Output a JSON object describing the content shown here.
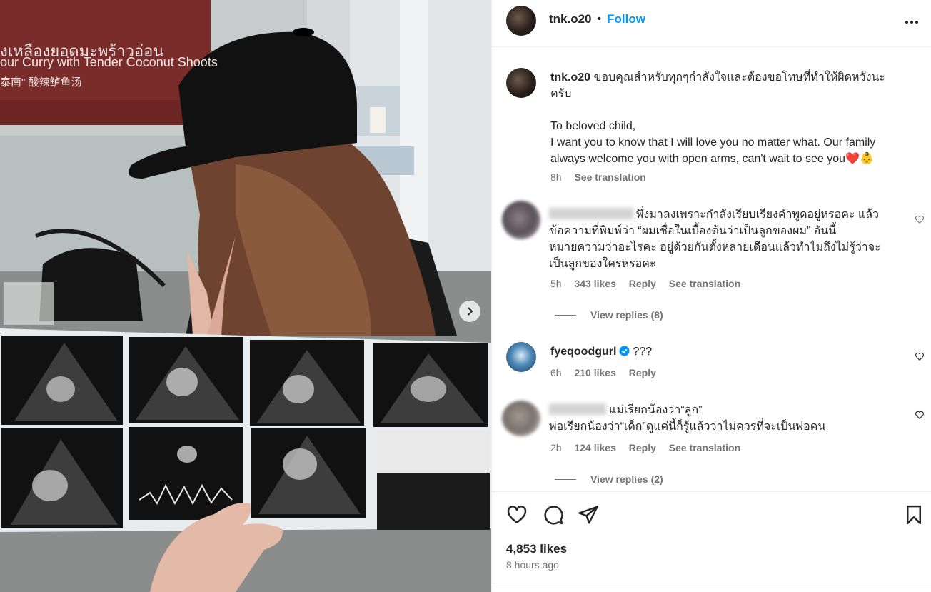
{
  "post": {
    "username": "tnk.o20",
    "separator": "•",
    "follow_label": "Follow",
    "caption_line1": "ขอบคุณสำหรับทุกๆกำลังใจและต้องขอโทษที่ทำให้ผิดหวังนะ",
    "caption_line2": "ครับ",
    "caption_en1": "To beloved child,",
    "caption_en2": "I want you to know that I will love you no matter what. Our family",
    "caption_en3": "always welcome you with open arms, can't wait to see you",
    "caption_emoji": "❤️👶",
    "caption_time": "8h",
    "see_translation": "See translation"
  },
  "media_sign": {
    "thai": "งเหลืองยอดมะพร้าวอ่อน",
    "en": "our Curry with Tender Coconut Shoots",
    "cn": "泰南\" 酸辣鲈鱼汤"
  },
  "comments": [
    {
      "line1": "พึ่งมาลงเพราะกำลังเรียบเรียงคำพูดอยู่หรอคะ แล้ว",
      "line2": "ข้อความที่พิมพ์ว่า “ผมเชื่อในเบื้องต้นว่าเป็นลูกของผม” อันนี้",
      "line3": "หมายความว่าอะไรคะ อยู่ด้วยกันตั้งหลายเดือนแล้วทำไมถึงไม่รู้ว่าจะ",
      "line4": "เป็นลูกของใครหรอคะ",
      "time": "5h",
      "likes": "343 likes",
      "reply": "Reply",
      "see_translation": "See translation",
      "view_replies": "View replies (8)"
    },
    {
      "username": "fyeqoodgurl",
      "text": "???",
      "time": "6h",
      "likes": "210 likes",
      "reply": "Reply"
    },
    {
      "line1": "แม่เรียกน้องว่า“ลูก”",
      "line2": "พ่อเรียกน้องว่า“เด็ก”ดูแค่นี้ก็รู้แล้วว่าไม่ควรที่จะเป็นพ่อคน",
      "time": "2h",
      "likes": "124 likes",
      "reply": "Reply",
      "see_translation": "See translation",
      "view_replies": "View replies (2)"
    }
  ],
  "footer": {
    "likes": "4,853 likes",
    "time_ago": "8 hours ago"
  },
  "icons": {
    "more": "more-options-icon",
    "like": "heart-icon",
    "comment": "comment-icon",
    "share": "share-icon",
    "save": "bookmark-icon",
    "next": "chevron-right-icon",
    "verified": "verified-badge-icon"
  },
  "colors": {
    "accent": "#0095f6",
    "text": "#262626",
    "muted": "#737373",
    "heart": "#e0245e"
  }
}
